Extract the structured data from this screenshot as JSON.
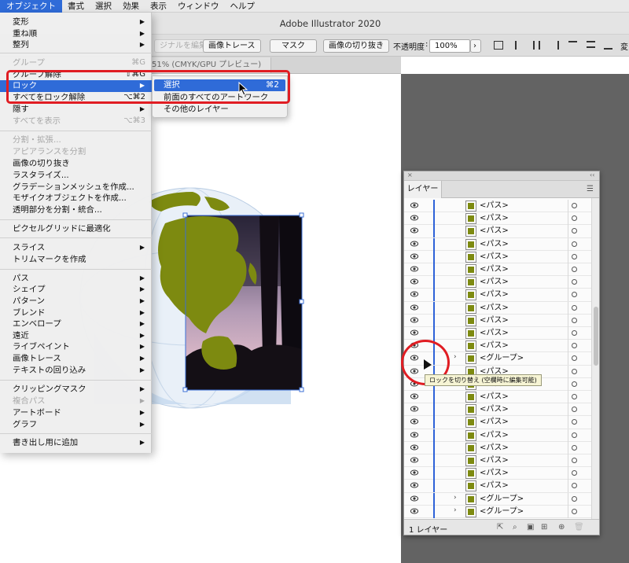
{
  "app": {
    "title": "Adobe Illustrator 2020"
  },
  "menubar": {
    "items": [
      "オブジェクト",
      "書式",
      "選択",
      "効果",
      "表示",
      "ウィンドウ",
      "ヘルプ"
    ]
  },
  "controlbar": {
    "original_btn": "ジナルを編集",
    "trace_btn": "画像トレース",
    "mask_btn": "マスク",
    "crop_btn": "画像の切り抜き",
    "opacity_label": "不透明度",
    "opacity_value": "100%",
    "overflow": "変"
  },
  "doc_tab": {
    "label": "51% (CMYK/GPU プレビュー)"
  },
  "object_menu": {
    "items": [
      {
        "label": "変形",
        "arrow": "▶"
      },
      {
        "label": "重ね順",
        "arrow": "▶"
      },
      {
        "label": "整列",
        "arrow": "▶"
      },
      {
        "label": "グループ",
        "shortcut": "⌘G",
        "disabled": true
      },
      {
        "label": "グループ解除",
        "shortcut": "⇧⌘G"
      },
      {
        "label": "ロック",
        "arrow": "▶",
        "highlighted": true
      },
      {
        "label": "すべてをロック解除",
        "shortcut": "⌥⌘2"
      },
      {
        "label": "隠す",
        "arrow": "▶"
      },
      {
        "label": "すべてを表示",
        "shortcut": "⌥⌘3",
        "disabled": true
      },
      {
        "label": "分割・拡張...",
        "disabled": true
      },
      {
        "label": "アピアランスを分割",
        "disabled": true
      },
      {
        "label": "画像の切り抜き"
      },
      {
        "label": "ラスタライズ..."
      },
      {
        "label": "グラデーションメッシュを作成..."
      },
      {
        "label": "モザイクオブジェクトを作成..."
      },
      {
        "label": "透明部分を分割・統合..."
      },
      {
        "label": "ピクセルグリッドに最適化"
      },
      {
        "label": "スライス",
        "arrow": "▶"
      },
      {
        "label": "トリムマークを作成"
      },
      {
        "label": "パス",
        "arrow": "▶"
      },
      {
        "label": "シェイプ",
        "arrow": "▶"
      },
      {
        "label": "パターン",
        "arrow": "▶"
      },
      {
        "label": "ブレンド",
        "arrow": "▶"
      },
      {
        "label": "エンベロープ",
        "arrow": "▶"
      },
      {
        "label": "遠近",
        "arrow": "▶"
      },
      {
        "label": "ライブペイント",
        "arrow": "▶"
      },
      {
        "label": "画像トレース",
        "arrow": "▶"
      },
      {
        "label": "テキストの回り込み",
        "arrow": "▶"
      },
      {
        "label": "クリッピングマスク",
        "arrow": "▶"
      },
      {
        "label": "複合パス",
        "arrow": "▶",
        "disabled": true
      },
      {
        "label": "アートボード",
        "arrow": "▶"
      },
      {
        "label": "グラフ",
        "arrow": "▶"
      },
      {
        "label": "書き出し用に追加",
        "arrow": "▶"
      }
    ]
  },
  "lock_submenu": {
    "items": [
      {
        "label": "選択",
        "shortcut": "⌘2",
        "highlighted": true
      },
      {
        "label": "前面のすべてのアートワーク"
      },
      {
        "label": "その他のレイヤー"
      }
    ]
  },
  "layers_panel": {
    "tab": "レイヤー",
    "count_label": "1 レイヤー",
    "tooltip": "ロックを切り替え (空欄時に編集可能)",
    "rows": [
      {
        "name": "<パス>"
      },
      {
        "name": "<パス>"
      },
      {
        "name": "<パス>"
      },
      {
        "name": "<パス>"
      },
      {
        "name": "<パス>"
      },
      {
        "name": "<パス>"
      },
      {
        "name": "<パス>"
      },
      {
        "name": "<パス>"
      },
      {
        "name": "<パス>"
      },
      {
        "name": "<パス>"
      },
      {
        "name": "<パス>"
      },
      {
        "name": "<パス>"
      },
      {
        "name": "<グループ>",
        "expand": "›"
      },
      {
        "name": "<パス>"
      },
      {
        "name": "<パス>"
      },
      {
        "name": "<パス>"
      },
      {
        "name": "<パス>"
      },
      {
        "name": "<パス>"
      },
      {
        "name": "<パス>"
      },
      {
        "name": "<パス>"
      },
      {
        "name": "<パス>"
      },
      {
        "name": "<パス>"
      },
      {
        "name": "<パス>"
      },
      {
        "name": "<グループ>",
        "expand": "›"
      },
      {
        "name": "<グループ>",
        "expand": "›"
      }
    ]
  },
  "colors": {
    "accent": "#2f6bd8",
    "highlight_red": "#e01d23",
    "map_green": "#7d8a10"
  }
}
